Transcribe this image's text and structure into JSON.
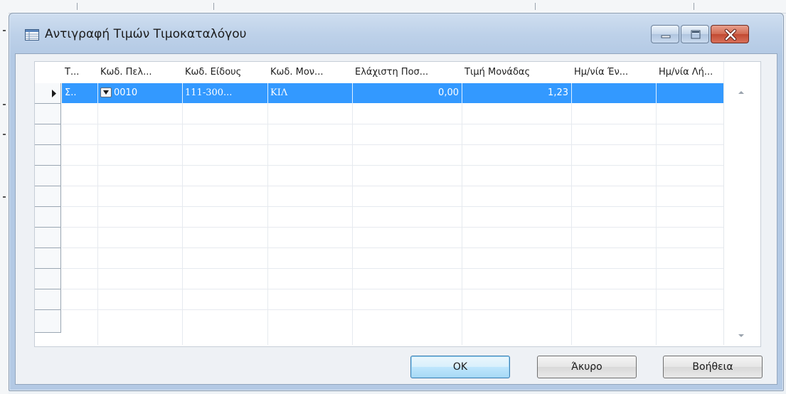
{
  "window": {
    "title": "Αντιγραφή Τιμών Τιμοκαταλόγου"
  },
  "grid": {
    "columns": [
      {
        "label": "Τ..."
      },
      {
        "label": "Κωδ. Πελ..."
      },
      {
        "label": "Κωδ. Είδους"
      },
      {
        "label": "Κωδ. Μον..."
      },
      {
        "label": "Ελάχιστη Ποσ..."
      },
      {
        "label": "Τιμή Μονάδας"
      },
      {
        "label": "Ημ/νία Έν..."
      },
      {
        "label": "Ημ/νία Λή..."
      }
    ],
    "rows": [
      {
        "type": "Σ..",
        "customer_code": "0010",
        "item_code": "111-300...",
        "unit_code": "ΚΙΛ",
        "min_qty": "0,00",
        "unit_price": "1,23",
        "start_date": "",
        "end_date": ""
      }
    ],
    "empty_rows": 10
  },
  "buttons": {
    "ok": "OK",
    "cancel": "Άκυρο",
    "help": "Βοήθεια"
  },
  "colors": {
    "selection": "#3399ff",
    "titlebar": "#bdd1e9",
    "close_button": "#c24a32"
  },
  "icons": [
    "table-icon",
    "minimize-icon",
    "maximize-icon",
    "close-icon",
    "row-pointer-icon",
    "dropdown-icon",
    "scroll-up-icon",
    "scroll-down-icon"
  ]
}
